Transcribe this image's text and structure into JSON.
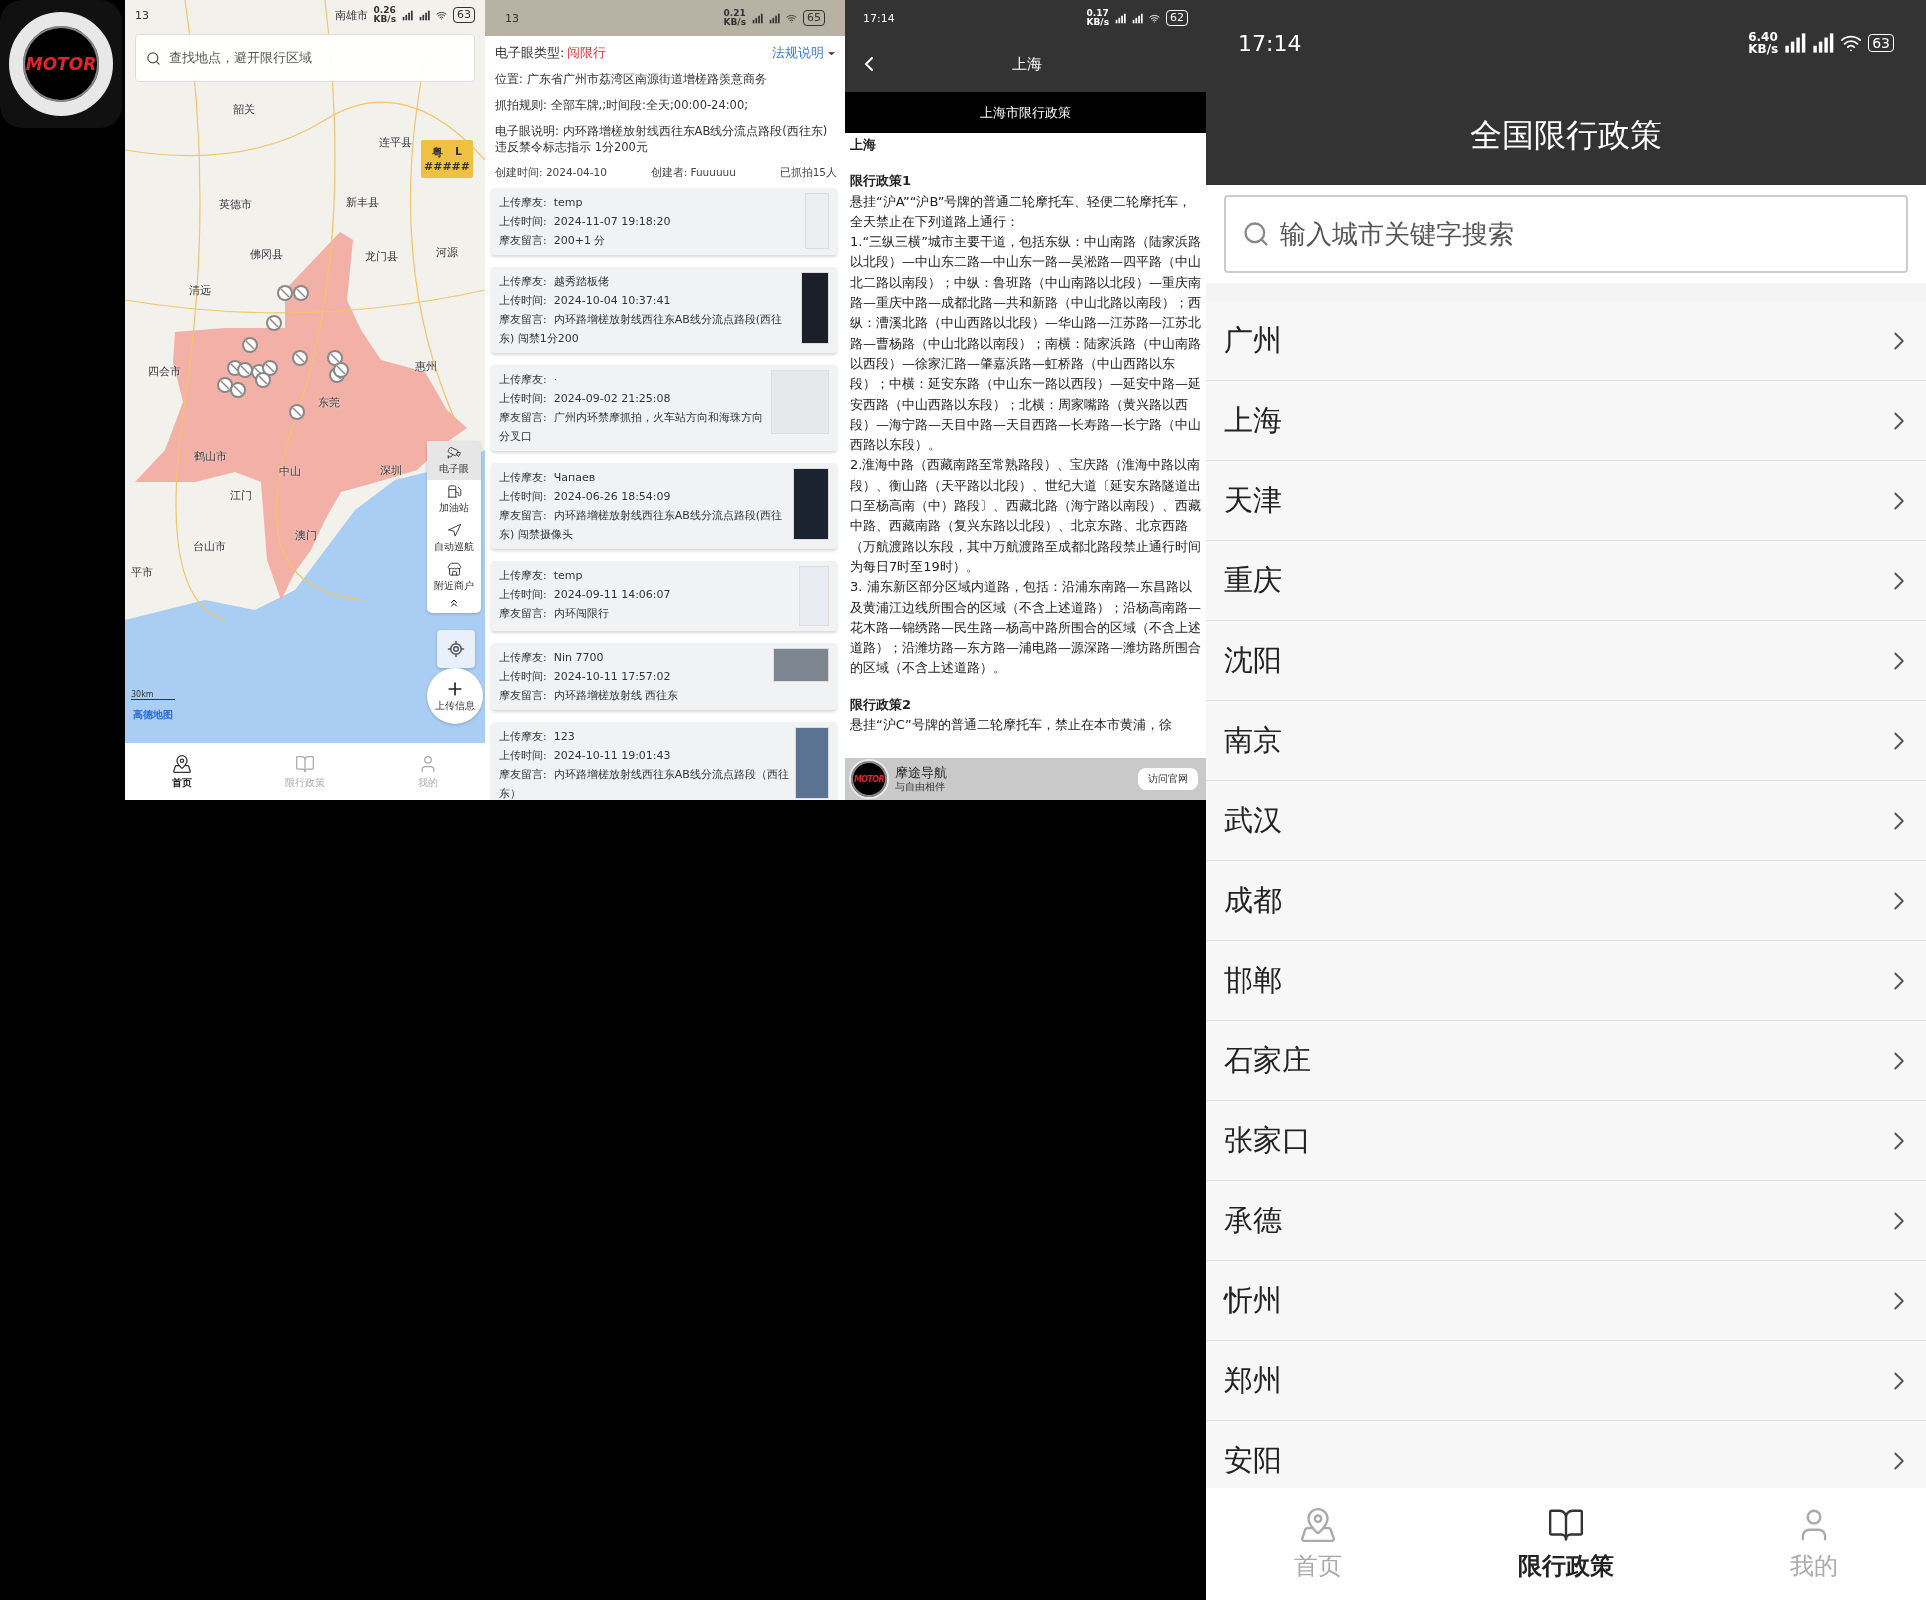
{
  "app_icon": {
    "text": "MOTOR"
  },
  "map_screen": {
    "status_bar": {
      "time": "13",
      "place": "南雄市",
      "speed": "0.26",
      "speed_unit": "KB/s",
      "battery": "63"
    },
    "search": {
      "placeholder": "查找地点，避开限行区域"
    },
    "map_labels": [
      "韶关",
      "连平县",
      "英德市",
      "新丰县",
      "佛冈县",
      "龙门县",
      "河源",
      "清远",
      "四会市",
      "惠州",
      "东莞",
      "鹤山市",
      "中山",
      "深圳",
      "江门",
      "澳门",
      "台山市",
      "平市"
    ],
    "plate": {
      "province": "粤",
      "letter": "L",
      "number": "#####"
    },
    "tools": [
      {
        "label": "电子眼",
        "selected": true
      },
      {
        "label": "加油站",
        "selected": false
      },
      {
        "label": "自动巡航",
        "selected": false
      },
      {
        "label": "附近商户",
        "selected": false
      }
    ],
    "upload": {
      "label": "上传信息"
    },
    "scale": "30km",
    "map_brand": "高德地图",
    "tabs": [
      {
        "label": "首页",
        "selected": true
      },
      {
        "label": "限行政策",
        "selected": false
      },
      {
        "label": "我的",
        "selected": false
      }
    ]
  },
  "camera_screen": {
    "status_bar": {
      "time": "13",
      "speed": "0.21",
      "speed_unit": "KB/s",
      "battery": "65"
    },
    "type_label": "电子眼类型:",
    "type_value": "闯限行",
    "rules_link": "法规说明",
    "details": [
      {
        "label": "位置:",
        "value": "广东省广州市荔湾区南源街道增槎路羡意商务"
      },
      {
        "label": "抓拍规则:",
        "value": "全部车牌,;时间段:全天;00:00-24:00;"
      },
      {
        "label": "电子眼说明:",
        "value": "内环路增槎放射线西往东AB线分流点路段(西往东) 违反禁令标志指示 1分200元"
      }
    ],
    "created": "创建时间: 2024-04-10",
    "creator": "创建者: Fuuuuuu",
    "count": "已抓拍15人",
    "reports": [
      {
        "user_label": "上传摩友:",
        "user": "temp",
        "time_label": "上传时间:",
        "time": "2024-11-07 19:18:20",
        "note_label": "摩友留言:",
        "note": "200+1 分"
      },
      {
        "user_label": "上传摩友:",
        "user": "越秀踏板佬",
        "time_label": "上传时间:",
        "time": "2024-10-04 10:37:41",
        "note_label": "摩友留言:",
        "note": "内环路增槎放射线西往东AB线分流点路段(西往东) 闯禁1分200"
      },
      {
        "user_label": "上传摩友:",
        "user": "·",
        "time_label": "上传时间:",
        "time": "2024-09-02 21:25:08",
        "note_label": "摩友留言:",
        "note": "广州内环禁摩抓拍，火车站方向和海珠方向分叉口"
      },
      {
        "user_label": "上传摩友:",
        "user": "Чапаев",
        "time_label": "上传时间:",
        "time": "2024-06-26 18:54:09",
        "note_label": "摩友留言:",
        "note": "内环路增槎放射线西往东AB线分流点路段(西往东) 闯禁摄像头"
      },
      {
        "user_label": "上传摩友:",
        "user": "temp",
        "time_label": "上传时间:",
        "time": "2024-09-11 14:06:07",
        "note_label": "摩友留言:",
        "note": "内环闯限行"
      },
      {
        "user_label": "上传摩友:",
        "user": "Nin 7700",
        "time_label": "上传时间:",
        "time": "2024-10-11 17:57:02",
        "note_label": "摩友留言:",
        "note": "内环路增槎放射线 西往东"
      },
      {
        "user_label": "上传摩友:",
        "user": "123",
        "time_label": "上传时间:",
        "time": "2024-10-11 19:01:43",
        "note_label": "摩友留言:",
        "note": "内环路增槎放射线西往东AB线分流点路段（西往东）"
      }
    ]
  },
  "policy_screen": {
    "status_bar": {
      "time": "17:14",
      "speed": "0.17",
      "speed_unit": "KB/s",
      "battery": "62"
    },
    "title": "上海",
    "band": "上海市限行政策",
    "city": "上海",
    "sections": [
      {
        "heading": "限行政策1",
        "paragraphs": [
          "悬挂“沪A”“沪B”号牌的普通二轮摩托车、轻便二轮摩托车，全天禁止在下列道路上通行：",
          "1.“三纵三横”城市主要干道，包括东纵：中山南路（陆家浜路以北段）—中山东二路—中山东一路—吴淞路—四平路（中山北二路以南段）；中纵：鲁班路（中山南路以北段）—重庆南路—重庆中路—成都北路—共和新路（中山北路以南段）；西纵：漕溪北路（中山西路以北段）—华山路—江苏路—江苏北路—曹杨路（中山北路以南段）；南横：陆家浜路（中山南路以西段）—徐家汇路—肇嘉浜路—虹桥路（中山西路以东段）；中横：延安东路（中山东一路以西段）—延安中路—延安西路（中山西路以东段）；北横：周家嘴路（黄兴路以西段）—海宁路—天目中路—天目西路—长寿路—长宁路（中山西路以东段）。",
          "2.淮海中路（西藏南路至常熟路段）、宝庆路（淮海中路以南段）、衡山路（天平路以北段）、世纪大道〔延安东路隧道出口至杨高南（中）路段〕、西藏北路（海宁路以南段）、西藏中路、西藏南路（复兴东路以北段）、北京东路、北京西路（万航渡路以东段，其中万航渡路至成都北路段禁止通行时间为每日7时至19时）。",
          "3. 浦东新区部分区域内道路，包括：沿浦东南路—东昌路以及黄浦江边线所围合的区域（不含上述道路）；沿杨高南路—花木路—锦绣路—民生路—杨高中路所围合的区域（不含上述道路）；沿潍坊路—东方路—浦电路—源深路—潍坊路所围合的区域（不含上述道路）。"
        ]
      },
      {
        "heading": "限行政策2",
        "paragraphs": [
          "悬挂“沪C”号牌的普通二轮摩托车，禁止在本市黄浦，徐"
        ]
      }
    ],
    "banner": {
      "logo_text": "MOTOR",
      "name": "摩途导航",
      "slogan": "与自由相伴",
      "button": "访问官网"
    }
  },
  "cities_screen": {
    "status_bar": {
      "time": "17:14",
      "speed": "6.40",
      "speed_unit": "KB/s",
      "battery": "63"
    },
    "title": "全国限行政策",
    "search": {
      "placeholder": "输入城市关键字搜索"
    },
    "cities": [
      "广州",
      "上海",
      "天津",
      "重庆",
      "沈阳",
      "南京",
      "武汉",
      "成都",
      "邯郸",
      "石家庄",
      "张家口",
      "承德",
      "忻州",
      "郑州",
      "安阳"
    ],
    "tabs": [
      {
        "label": "首页",
        "selected": false
      },
      {
        "label": "限行政策",
        "selected": true
      },
      {
        "label": "我的",
        "selected": false
      }
    ]
  }
}
